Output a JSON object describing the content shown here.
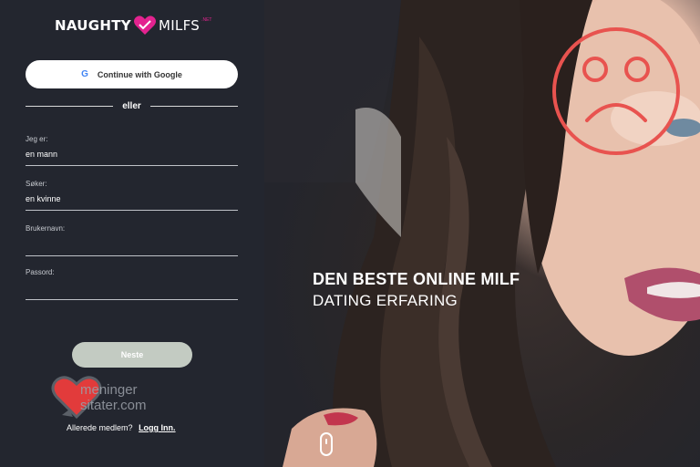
{
  "brand": {
    "word1": "NAUGHTY",
    "word2": "MILFS",
    "tld": ".NET"
  },
  "google_button": {
    "label": "Continue with Google",
    "icon": "google-icon"
  },
  "divider": {
    "label": "eller"
  },
  "form": {
    "fields": [
      {
        "label": "Jeg er:",
        "value": "en mann"
      },
      {
        "label": "Søker:",
        "value": "en kvinne"
      },
      {
        "label": "Brukernavn:",
        "value": ""
      },
      {
        "label": "Passord:",
        "value": ""
      }
    ],
    "next_label": "Neste"
  },
  "watermark": {
    "line1": "meninger",
    "line2": "sitater.com"
  },
  "member": {
    "text": "Allerede medlem?",
    "link": "Logg Inn."
  },
  "hero": {
    "line1": "DEN BESTE ONLINE MILF",
    "line2": "DATING ERFARING"
  },
  "colors": {
    "brand_pink": "#e3238f",
    "panel_bg": "#23262f",
    "next_button": "#c3cbc2",
    "sad_face": "#e8534f"
  },
  "icons": {
    "scroll": "mouse-scroll-icon",
    "overlay": "sad-face-icon"
  }
}
